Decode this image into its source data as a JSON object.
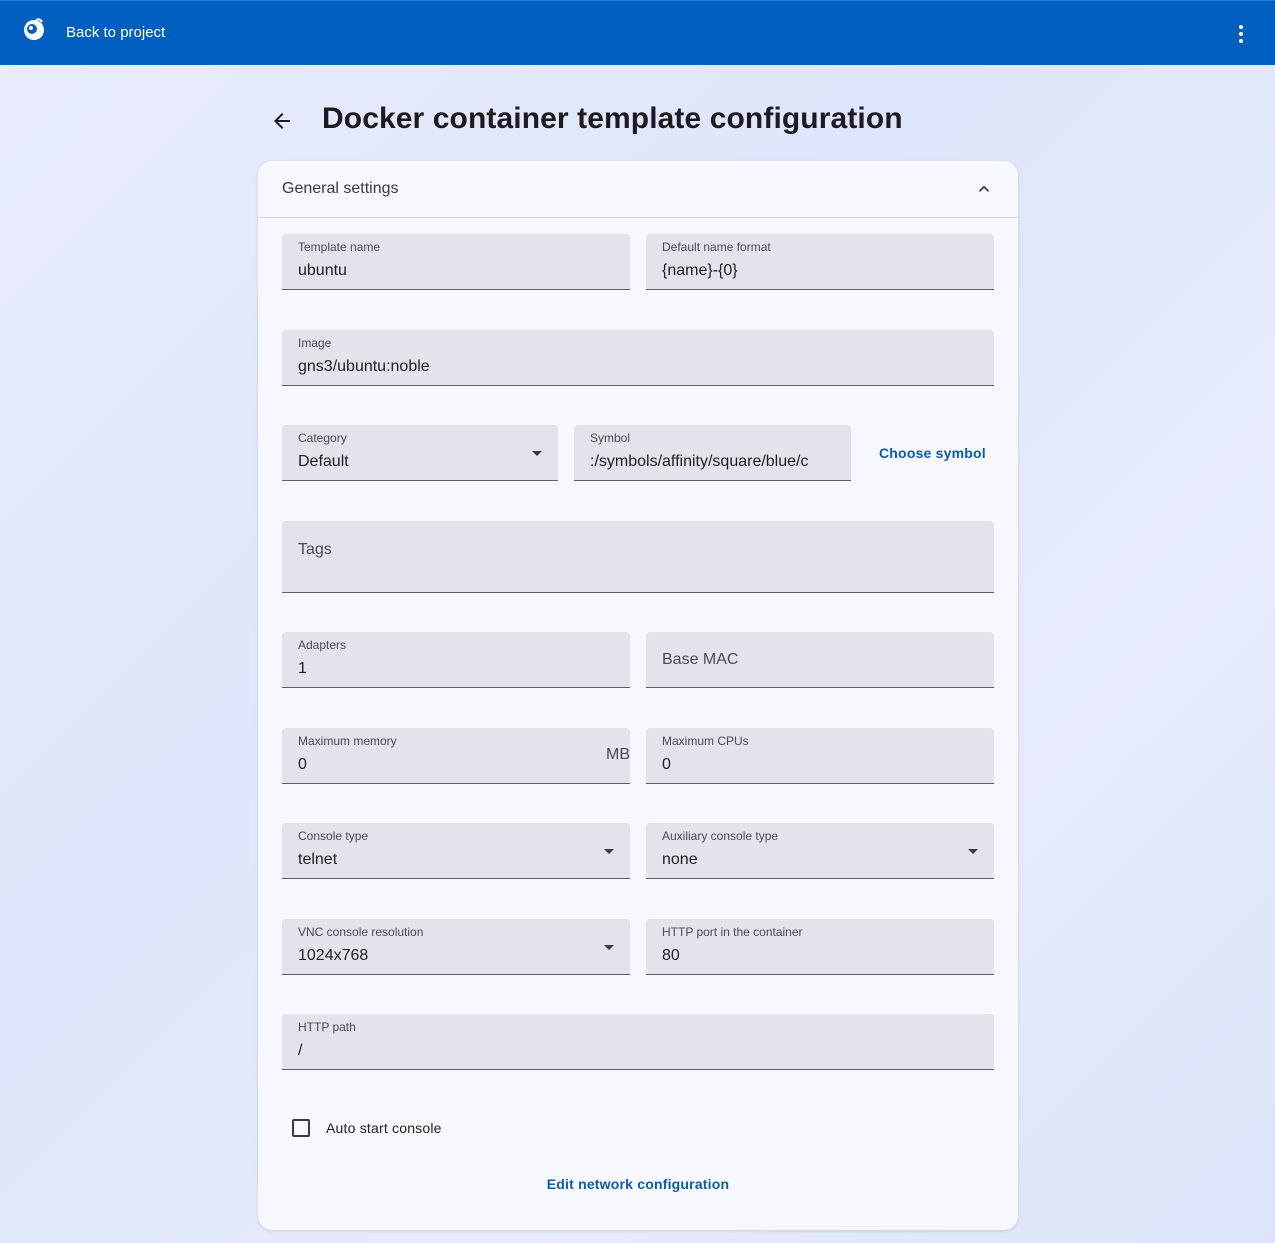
{
  "topbar": {
    "back_label": "Back to project"
  },
  "page": {
    "title": "Docker container template configuration"
  },
  "section": {
    "title": "General settings"
  },
  "fields": {
    "template_name": {
      "label": "Template name",
      "value": "ubuntu"
    },
    "default_name_format": {
      "label": "Default name format",
      "value": "{name}-{0}"
    },
    "image": {
      "label": "Image",
      "value": "gns3/ubuntu:noble"
    },
    "category": {
      "label": "Category",
      "value": "Default"
    },
    "symbol": {
      "label": "Symbol",
      "value": ":/symbols/affinity/square/blue/c"
    },
    "tags": {
      "placeholder": "Tags"
    },
    "adapters": {
      "label": "Adapters",
      "value": "1"
    },
    "base_mac": {
      "placeholder": "Base MAC"
    },
    "max_memory": {
      "label": "Maximum memory",
      "value": "0",
      "suffix": "MB"
    },
    "max_cpus": {
      "label": "Maximum CPUs",
      "value": "0"
    },
    "console_type": {
      "label": "Console type",
      "value": "telnet"
    },
    "aux_console_type": {
      "label": "Auxiliary console type",
      "value": "none"
    },
    "vnc_resolution": {
      "label": "VNC console resolution",
      "value": "1024x768"
    },
    "http_port": {
      "label": "HTTP port in the container",
      "value": "80"
    },
    "http_path": {
      "label": "HTTP path",
      "value": "/"
    }
  },
  "choose_symbol_label": "Choose symbol",
  "auto_start_console": {
    "label": "Auto start console",
    "checked": false
  },
  "edit_network_label": "Edit network configuration",
  "colors": {
    "topbar": "#005fbf",
    "accent_link": "#0b5cad",
    "field_bg": "#e2e4ec",
    "card_bg": "#f7f8fd"
  },
  "icons": {
    "logo": "gns3-chameleon-logo",
    "menu": "more-vertical-icon",
    "back": "arrow-left-icon",
    "collapse": "chevron-up-icon",
    "dropdown": "caret-down-icon"
  }
}
